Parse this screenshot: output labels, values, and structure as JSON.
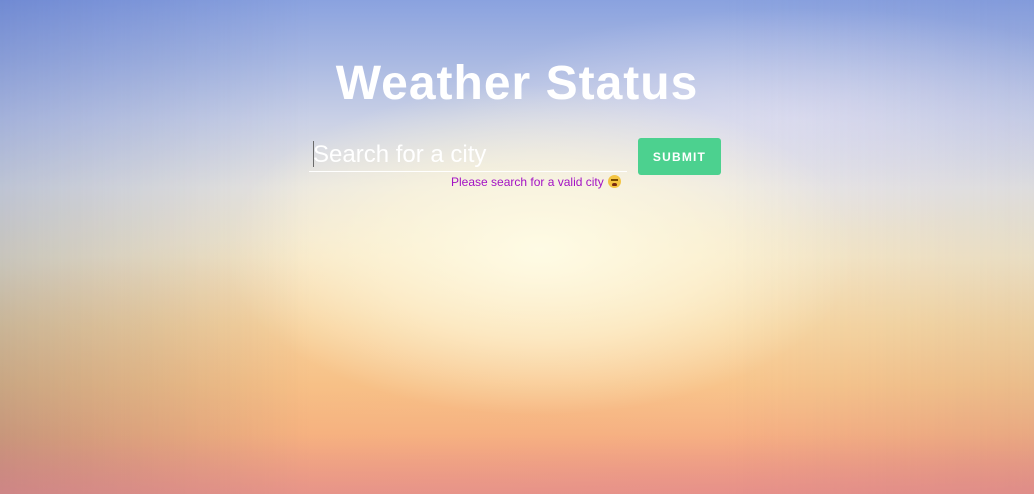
{
  "header": {
    "title": "Weather Status"
  },
  "search": {
    "placeholder": "Search for a city",
    "value": ""
  },
  "submit": {
    "label": "SUBMIT"
  },
  "error": {
    "message": "Please search for a valid city",
    "emoji": "weary-face-emoji"
  },
  "colors": {
    "submit_button": "#4cd18f",
    "error_text": "#a312c4",
    "title_text": "#ffffff"
  }
}
